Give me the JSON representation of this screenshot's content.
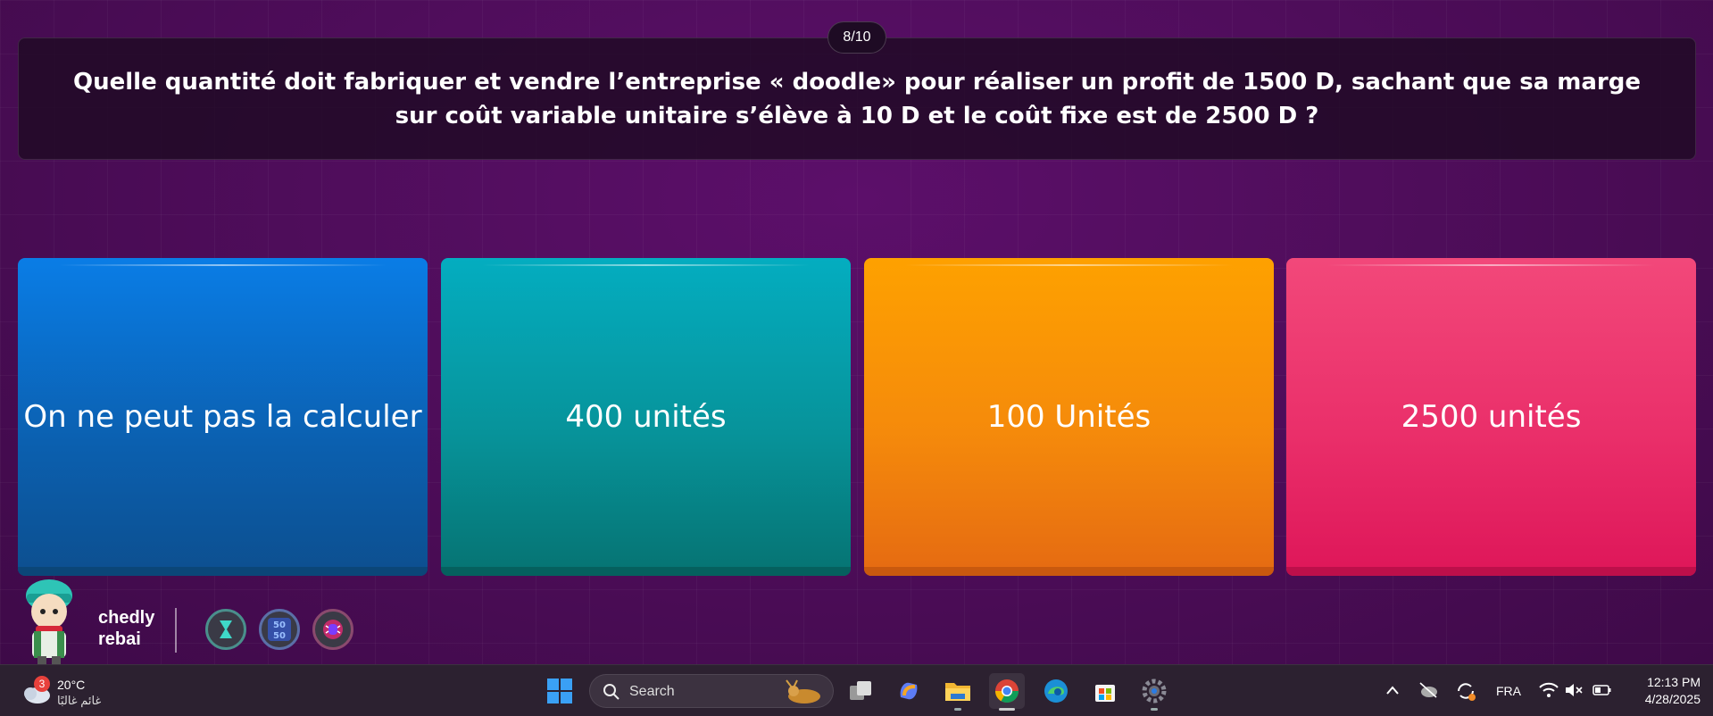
{
  "quiz": {
    "counter": "8/10",
    "question": "Quelle quantité doit fabriquer et vendre l’entreprise « doodle» pour réaliser un profit de 1500 D, sachant que sa marge sur coût variable unitaire s’élève à 10 D et le coût fixe est de 2500 D ?",
    "answers": [
      {
        "label": "On ne peut pas la calculer",
        "color": "#0a7de6"
      },
      {
        "label": "400 unités",
        "color": "#04adc0"
      },
      {
        "label": "100 Unités",
        "color": "#fea100"
      },
      {
        "label": "2500 unités",
        "color": "#f2487a"
      }
    ]
  },
  "player": {
    "first_name": "chedly",
    "last_name": "rebai",
    "powerups": [
      {
        "icon": "hourglass-icon"
      },
      {
        "icon": "fifty-fifty-icon",
        "label_top": "50",
        "label_bottom": "50"
      },
      {
        "icon": "bug-powerup-icon"
      }
    ]
  },
  "taskbar": {
    "weather": {
      "badge": "3",
      "temp": "20°C",
      "desc": "غائم غالبًا"
    },
    "search_label": "Search",
    "apps": [
      "windows-start-icon",
      "task-view-icon",
      "copilot-icon",
      "file-explorer-icon",
      "chrome-icon",
      "edge-icon",
      "store-icon",
      "settings-icon"
    ],
    "language": "FRA",
    "time": "12:13 PM",
    "date": "4/28/2025"
  }
}
